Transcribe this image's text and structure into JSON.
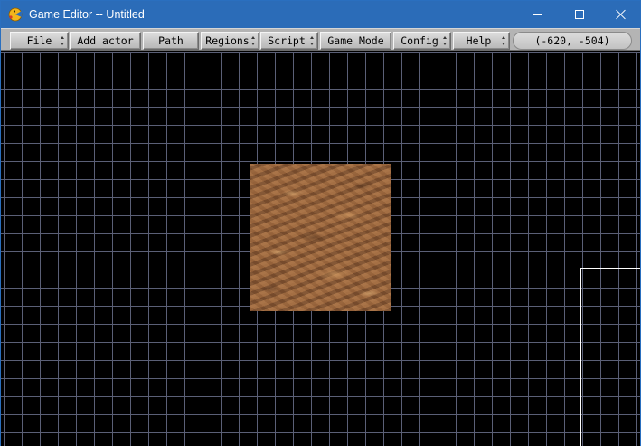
{
  "window": {
    "title": "Game Editor -- Untitled",
    "icon": "pacman-app-icon"
  },
  "toolbar": {
    "buttons": [
      {
        "label": "File",
        "has_dropdown": true
      },
      {
        "label": "Add actor",
        "has_dropdown": false
      },
      {
        "label": "Path",
        "has_dropdown": false
      },
      {
        "label": "Regions",
        "has_dropdown": true
      },
      {
        "label": "Script",
        "has_dropdown": true
      },
      {
        "label": "Game Mode",
        "has_dropdown": false
      },
      {
        "label": "Config",
        "has_dropdown": true
      },
      {
        "label": "Help",
        "has_dropdown": true
      }
    ],
    "coordinates": "(-620, -504)"
  },
  "canvas": {
    "background_color": "#000000",
    "grid_color": "#5a5f76",
    "actor": {
      "texture": "brown-rock-texture"
    },
    "view_border_color": "#ffffff"
  }
}
